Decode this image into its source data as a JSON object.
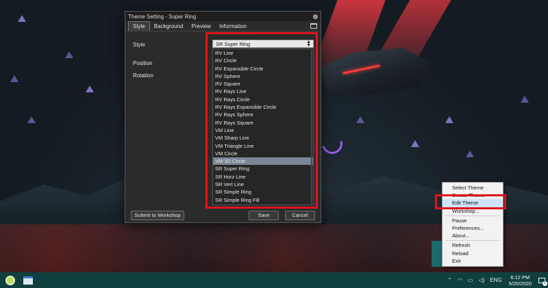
{
  "dialog": {
    "title": "Theme Setting - Super Ring",
    "tabs": [
      "Style",
      "Background",
      "Preview",
      "Information"
    ],
    "labels": {
      "style": "Style",
      "position": "Position",
      "rotation": "Rotation"
    },
    "style_select": {
      "value": "SR Super Ring"
    },
    "style_options": [
      "RV Line",
      "RV Circle",
      "RV Expansible Circle",
      "RV Sphere",
      "RV Square",
      "RV Rays Line",
      "RV Rays Circle",
      "RV Rays Expansible Circle",
      "RV Rays Sphere",
      "RV Rays Square",
      "VM Line",
      "VM Sharp Line",
      "VM Triangle Line",
      "VM Circle",
      "VM 3D Circle",
      "SR Super Ring",
      "SR Horz Line",
      "SR Vert Line",
      "SR Simple Ring",
      "SR Simple Ring Fill"
    ],
    "selected_option": "VM 3D Circle",
    "buttons": {
      "workshop": "Submit to Workshop",
      "save": "Save",
      "cancel": "Cancel"
    }
  },
  "context_menu": {
    "items": [
      {
        "label": "Select Theme"
      },
      {
        "label": "Create Theme"
      },
      {
        "label": "Edit Theme"
      },
      {
        "label": "Workshop..."
      },
      {
        "label": "Pause"
      },
      {
        "label": "Preferences..."
      },
      {
        "label": "About..."
      },
      {
        "label": "Refresh"
      },
      {
        "label": "Reload"
      },
      {
        "label": "Exit"
      }
    ],
    "highlighted": "Edit Theme"
  },
  "taskbar": {
    "language": "ENG",
    "time": "6:12 PM",
    "date": "5/25/2020",
    "notification_count": "1"
  },
  "colors": {
    "highlight": "#e0141c",
    "taskbar": "#0f3f3f",
    "selection": "#7a8696"
  }
}
